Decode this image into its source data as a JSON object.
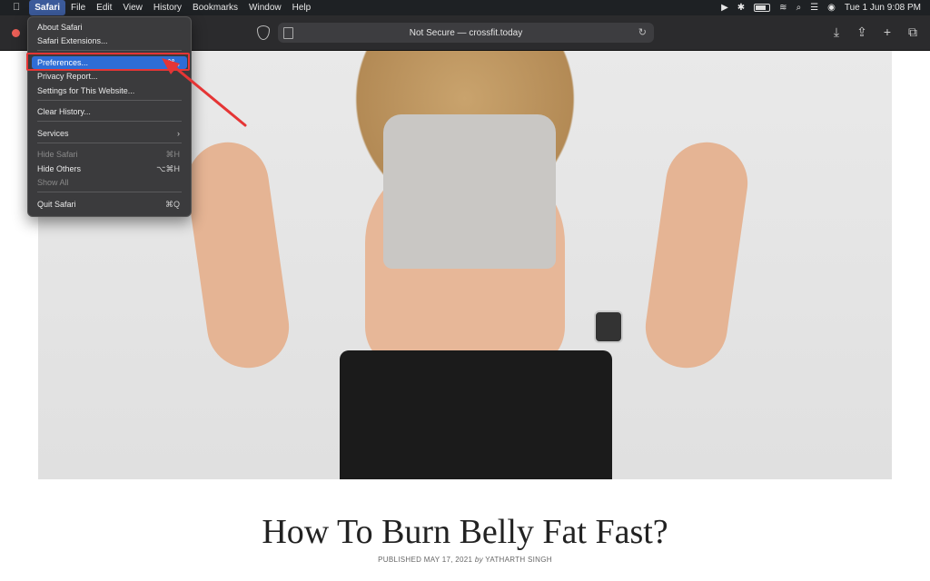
{
  "menubar": {
    "items": [
      "Safari",
      "File",
      "Edit",
      "View",
      "History",
      "Bookmarks",
      "Window",
      "Help"
    ],
    "datetime": "Tue 1 Jun  9:08 PM"
  },
  "toolbar": {
    "address": "Not Secure — crossfit.today"
  },
  "menu": {
    "items": [
      {
        "label": "About Safari",
        "shortcut": ""
      },
      {
        "label": "Safari Extensions...",
        "shortcut": ""
      },
      {
        "label": "Preferences...",
        "shortcut": "⌘ ,"
      },
      {
        "label": "Privacy Report...",
        "shortcut": ""
      },
      {
        "label": "Settings for This Website...",
        "shortcut": ""
      },
      {
        "label": "Clear History...",
        "shortcut": ""
      },
      {
        "label": "Services",
        "shortcut": "›"
      },
      {
        "label": "Hide Safari",
        "shortcut": "⌘H"
      },
      {
        "label": "Hide Others",
        "shortcut": "⌥⌘H"
      },
      {
        "label": "Show All",
        "shortcut": ""
      },
      {
        "label": "Quit Safari",
        "shortcut": "⌘Q"
      }
    ]
  },
  "article": {
    "title": "How To Burn Belly Fat Fast?",
    "meta_prefix": "PUBLISHED MAY 17, 2021",
    "meta_by": "by",
    "meta_author": "YATHARTH SINGH"
  },
  "colors": {
    "highlight": "#2e6dd6",
    "annotation": "#e53535"
  }
}
